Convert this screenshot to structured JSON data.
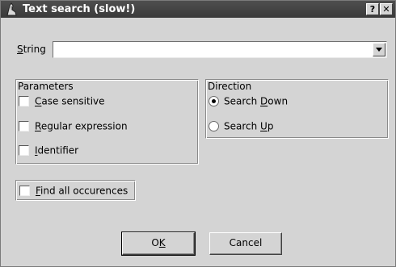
{
  "window": {
    "title": "Text search (slow!)",
    "help_label": "?",
    "close_label": "✕"
  },
  "string": {
    "label_mnemonic": "S",
    "label_rest": "tring",
    "value": "",
    "dropdown_icon": "chevron-down-icon"
  },
  "parameters": {
    "title": "Parameters",
    "options": [
      {
        "mnemonic": "C",
        "rest": "ase sensitive",
        "checked": false
      },
      {
        "mnemonic": "R",
        "rest": "egular expression",
        "checked": false
      },
      {
        "mnemonic": "I",
        "rest": "dentifier",
        "checked": false
      }
    ]
  },
  "direction": {
    "title": "Direction",
    "options": [
      {
        "before": "Search ",
        "mnemonic": "D",
        "after": "own",
        "selected": true
      },
      {
        "before": "Search ",
        "mnemonic": "U",
        "after": "p",
        "selected": false
      }
    ]
  },
  "find_all": {
    "mnemonic": "F",
    "rest": "ind all occurences",
    "checked": false
  },
  "buttons": {
    "ok_before": "O",
    "ok_mnemonic": "K",
    "cancel": "Cancel"
  }
}
